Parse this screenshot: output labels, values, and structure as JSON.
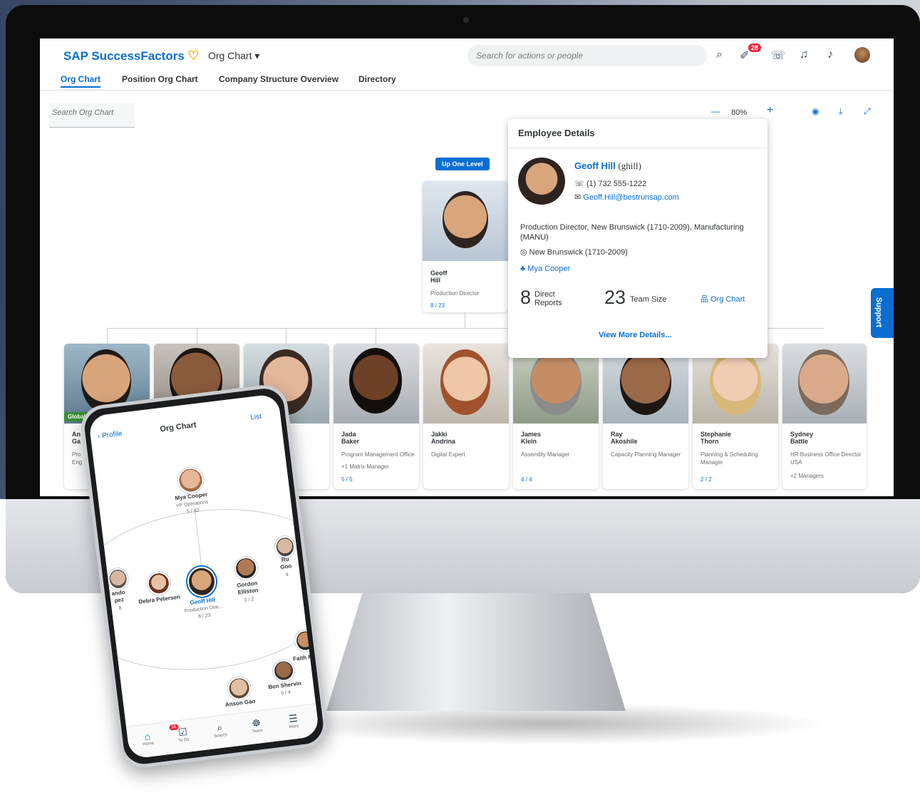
{
  "header": {
    "brand": "SAP SuccessFactors",
    "brand_heart": "♡",
    "app_title": "Org Chart ▾",
    "search_placeholder": "Search for actions or people",
    "notification_badge": "28",
    "icons": [
      "search-icon",
      "approvals-icon",
      "chat-icon",
      "headset-icon",
      "bell-icon",
      "avatar"
    ]
  },
  "tabs": [
    "Org Chart",
    "Position Org Chart",
    "Company Structure Overview",
    "Directory"
  ],
  "org_search_placeholder": "Search Org Chart",
  "zoom": {
    "minus": "—",
    "value": "80%",
    "plus": "+"
  },
  "up_one_level": "Up One Level",
  "manager_card": {
    "first": "Geoff",
    "last": "Hill",
    "title": "Production Director",
    "count": "8 / 23"
  },
  "details": {
    "title": "Employee Details",
    "name": "Geoff Hill",
    "username": "(ghill)",
    "phone": "(1) 732 555-1222",
    "email": "Geoff.Hill@bestrunsap.com",
    "position": "Production Director, New Brunswick (1710-2009), Manufacturing (MANU)",
    "location": "New Brunswick (1710-2009)",
    "manager": "Mya Cooper",
    "direct_reports_num": "8",
    "direct_reports_label": "Direct Reports",
    "team_size_num": "23",
    "team_size_label": "Team Size",
    "org_chart_link": "Org Chart",
    "view_more": "View More Details..."
  },
  "support": "Support",
  "reports": [
    {
      "first": "An",
      "last": "Ga",
      "title": "Pro",
      "title2": "Eng",
      "count": "",
      "tag": "Global Assignment"
    },
    {
      "first": "",
      "last": "",
      "title": "",
      "title2": "",
      "count": ""
    },
    {
      "first": "th",
      "last": "shall",
      "title": "ordinator",
      "title2": "",
      "count": ""
    },
    {
      "first": "Jada",
      "last": "Baker",
      "title": "Program Management Office",
      "title2": "+1 Matrix Manager",
      "count": "5 / 5"
    },
    {
      "first": "Jakki",
      "last": "Andrina",
      "title": "Digital Expert",
      "title2": "",
      "count": ""
    },
    {
      "first": "James",
      "last": "Klein",
      "title": "Assembly Manager",
      "title2": "",
      "count": "4 / 4"
    },
    {
      "first": "Ray",
      "last": "Akoshile",
      "title": "Capacity Planning Manager",
      "title2": "",
      "count": ""
    },
    {
      "first": "Stephanie",
      "last": "Thorn",
      "title": "Planning & Scheduling",
      "title2": "Manager",
      "count": "2 / 2"
    },
    {
      "first": "Sydney",
      "last": "Battle",
      "title": "HR Business Office Director",
      "title2": "USA",
      "count": "+2 Managers"
    }
  ],
  "phone": {
    "back": "Profile",
    "title": "Org Chart",
    "list": "List",
    "top": {
      "name": "Mya Cooper",
      "title": "VP Operations",
      "count": "5 / 42"
    },
    "center": {
      "name": "Geoff Hill",
      "title": "Production Dire...",
      "count": "8 / 23"
    },
    "left1": {
      "name": "Debra Petersen"
    },
    "left0": {
      "name": "ando",
      "name2": "pez",
      "count": "8"
    },
    "right1": {
      "name": "Gordon Elliston",
      "count": "2 / 2"
    },
    "right0": {
      "name": "Ru",
      "name2": "Goo",
      "count": "4"
    },
    "bottom1": {
      "name": "Anson Gao"
    },
    "bottom2": {
      "name": "Ben Shervin",
      "count": "5 / 4"
    },
    "bottom3": {
      "name": "Faith M"
    },
    "nav": [
      "Home",
      "To Do",
      "Search",
      "Team",
      "More"
    ],
    "todo_badge": "16"
  }
}
